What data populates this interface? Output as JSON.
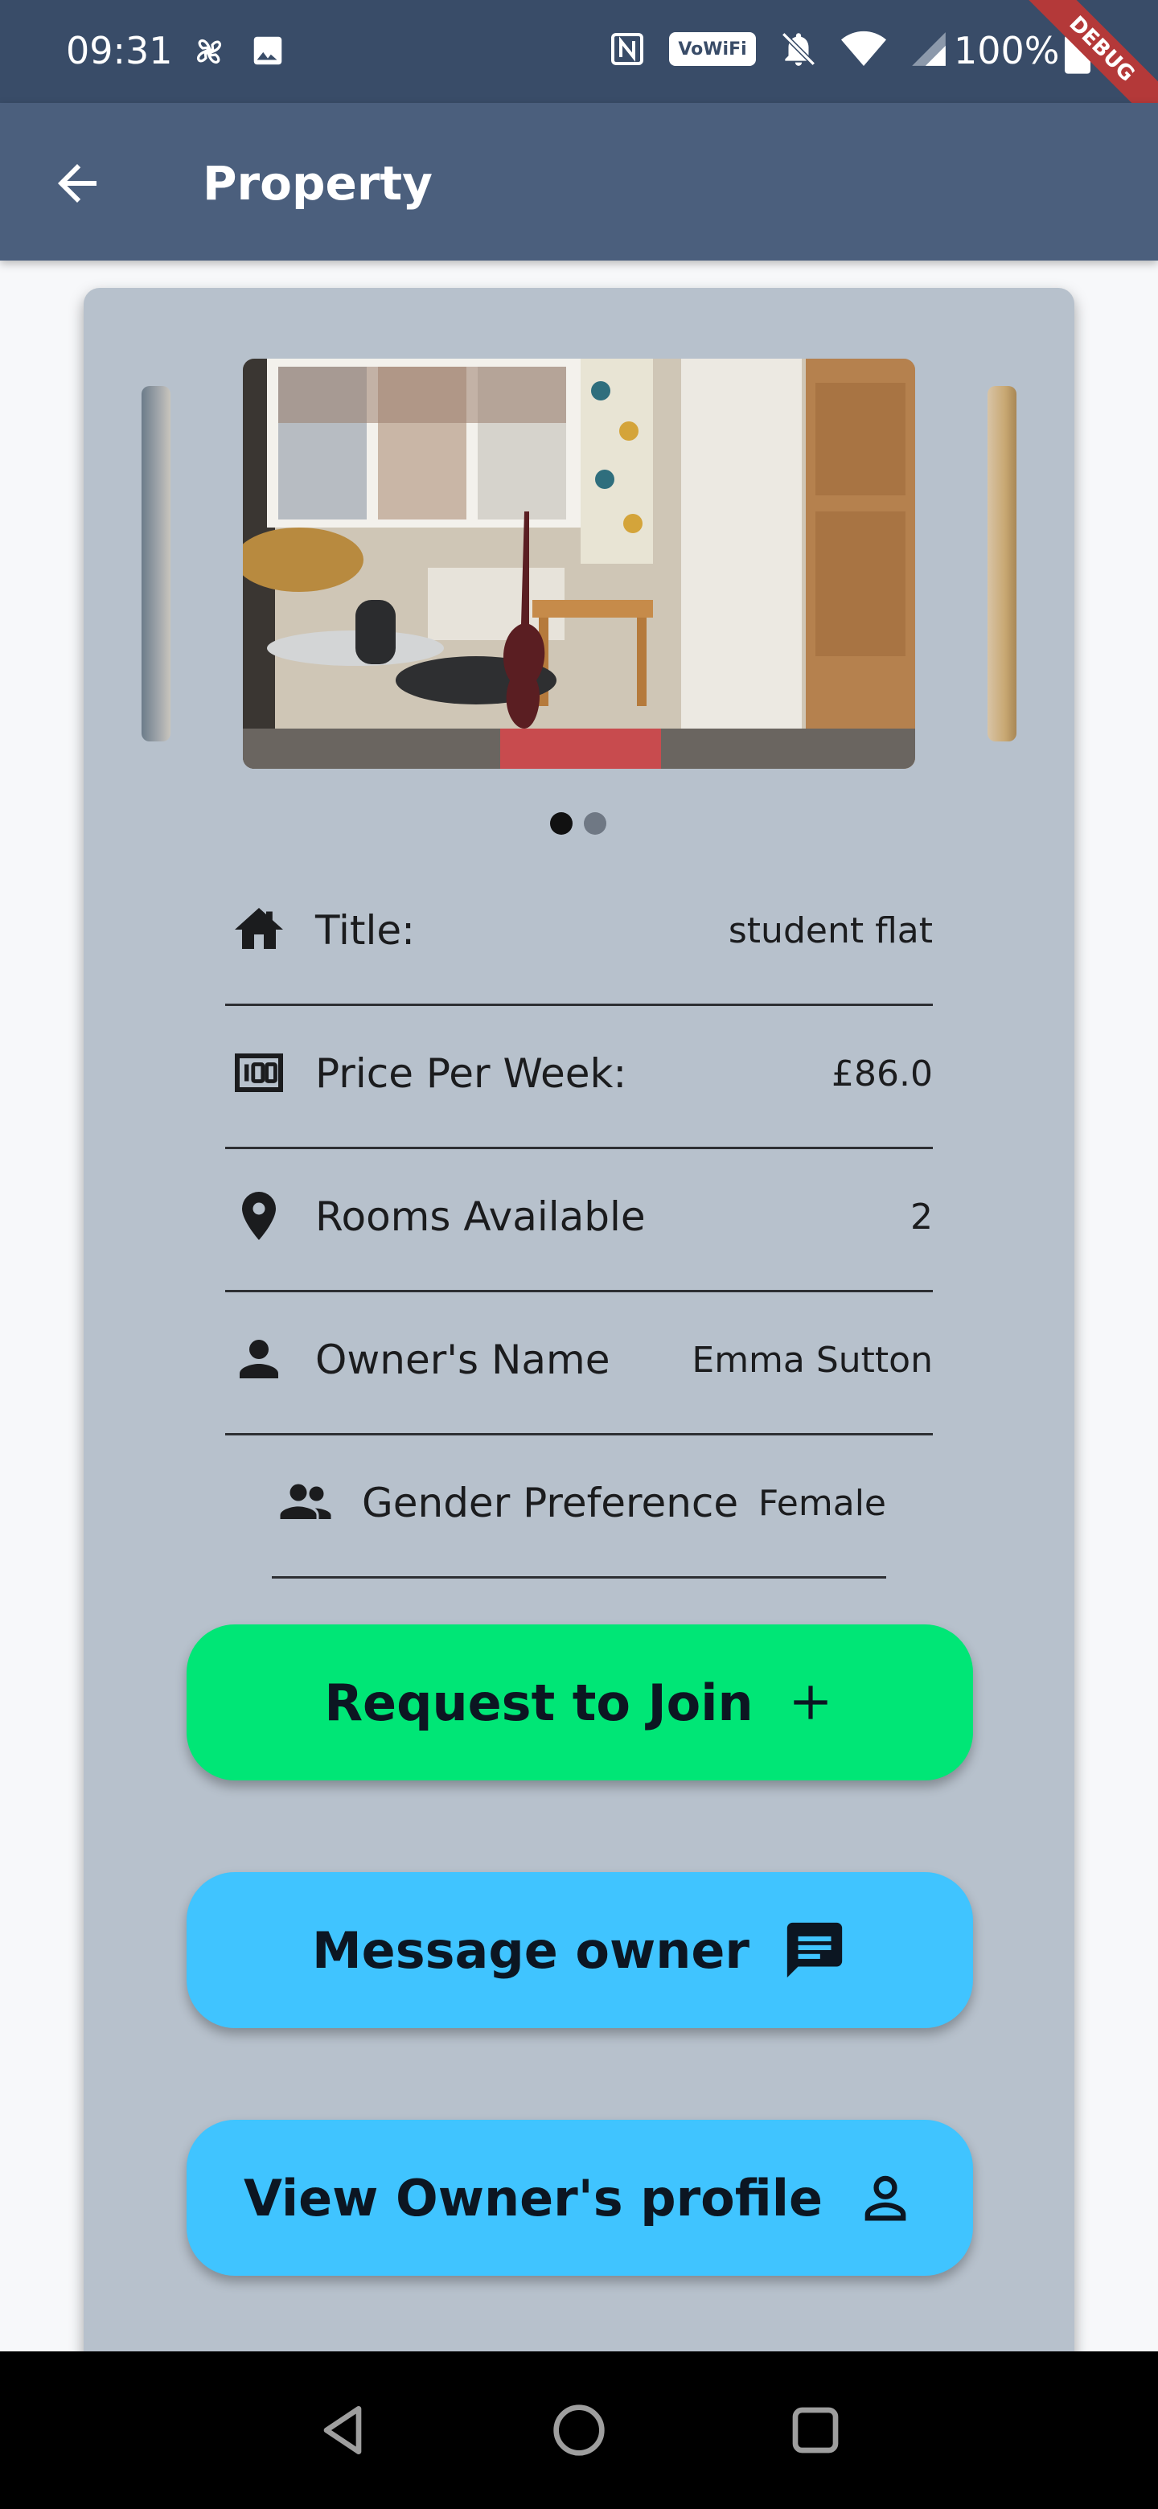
{
  "status_bar": {
    "time": "09:31",
    "battery_text": "100%",
    "wifi_badge": "VoWiFi",
    "debug_banner": "DEBUG"
  },
  "app_bar": {
    "title": "Property"
  },
  "carousel": {
    "image_count": 2,
    "active_index": 0
  },
  "details": [
    {
      "icon": "home-icon",
      "label": "Title:",
      "value": "student flat"
    },
    {
      "icon": "price-icon",
      "label": "Price Per Week:",
      "value": "£86.0"
    },
    {
      "icon": "location-pin-icon",
      "label": "Rooms Available",
      "value": "2"
    },
    {
      "icon": "person-icon",
      "label": "Owner's Name",
      "value": "Emma Sutton"
    },
    {
      "icon": "people-icon",
      "label": "Gender Preference",
      "value": "Female"
    }
  ],
  "buttons": {
    "join": "Request to Join",
    "message": "Message owner",
    "profile": "View Owner's profile"
  },
  "colors": {
    "status_bar": "#394c68",
    "app_bar": "#4b5f7d",
    "card": "#b7c1cc",
    "join_button": "#00e676",
    "secondary_button": "#40c4ff"
  }
}
